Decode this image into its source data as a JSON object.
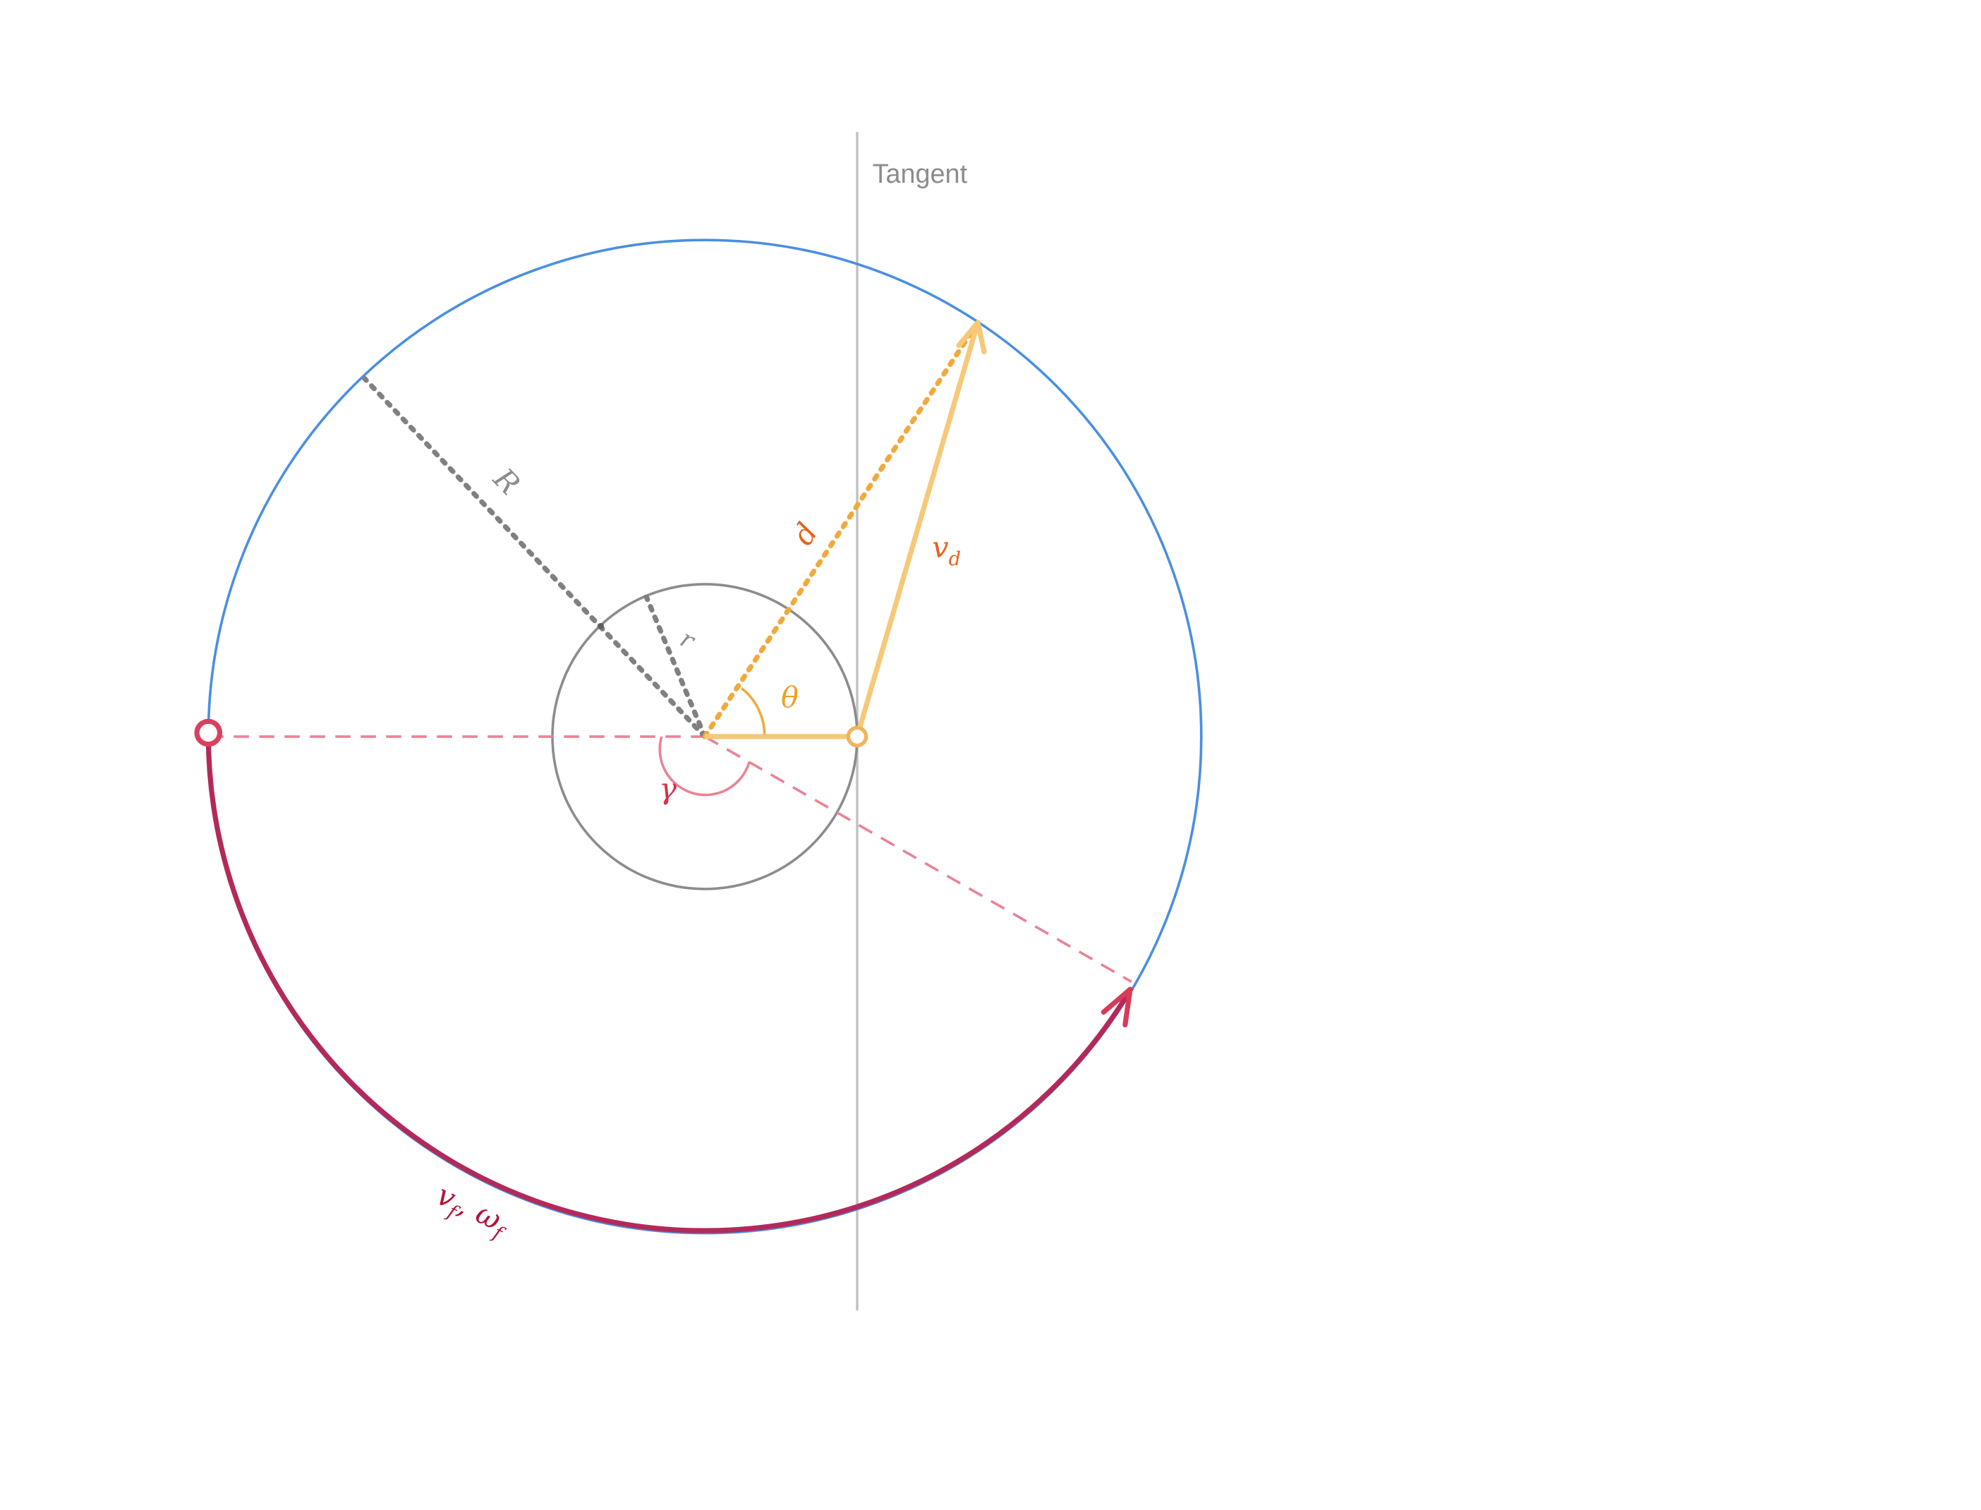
{
  "labels": {
    "tangent": "Tangent",
    "big_radius": "R",
    "small_radius": "r",
    "distance": "d",
    "theta": "θ",
    "gamma": "γ",
    "v_d_main": "v",
    "v_d_sub": "d",
    "v_f_main": "v",
    "v_f_sub": "f",
    "comma": ",",
    "omega_f_main": "ω",
    "omega_f_sub": "f"
  },
  "colors": {
    "outer_circle": "#4a8fe0",
    "inner_circle": "#8c8c8c",
    "tangent_line": "#c4c4c4",
    "tangent_text": "#8c8c8c",
    "radius_dots": "#808080",
    "radius_text": "#8c8c8c",
    "distance_dots": "#f2a93b",
    "orange_text": "#e8621a",
    "theta_text": "#eba22a",
    "velocity_vector": "#f7c878",
    "origin_marker": "#f0b45c",
    "gamma_dashes": "#eb8295",
    "gamma_text": "#d6304a",
    "target_marker": "#d9415c",
    "arc_path": "#b3295a",
    "arc_arrowhead": "#d63c5a",
    "arc_text": "#b3123a"
  }
}
